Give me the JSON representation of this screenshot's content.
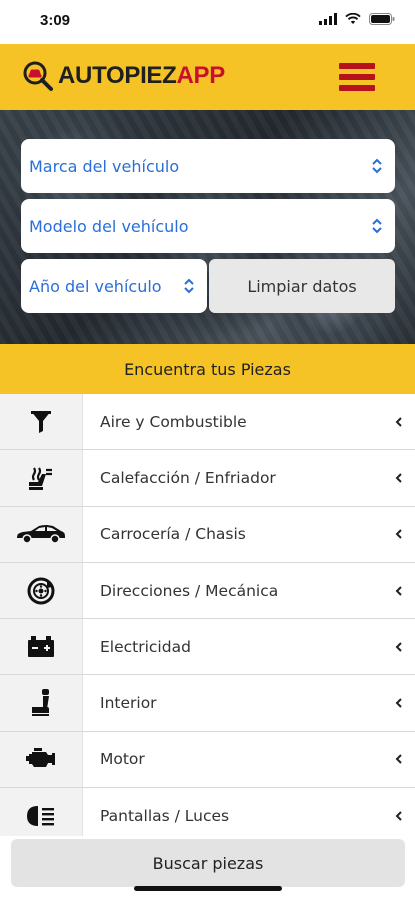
{
  "status_bar": {
    "time": "3:09"
  },
  "header": {
    "logo_part1": "AUTOPIEZ",
    "logo_part2": "APP"
  },
  "filters": {
    "brand_label": "Marca del vehículo",
    "model_label": "Modelo del vehículo",
    "year_label": "Año del vehículo",
    "clear_label": "Limpiar datos"
  },
  "section_title": "Encuentra tus Piezas",
  "categories": [
    {
      "label": "Aire y Combustible",
      "icon": "funnel-icon"
    },
    {
      "label": "Calefacción / Enfriador",
      "icon": "climate-seat-icon"
    },
    {
      "label": "Carrocería / Chasis",
      "icon": "car-icon"
    },
    {
      "label": "Direcciones / Mecánica",
      "icon": "brake-disc-icon"
    },
    {
      "label": "Electricidad",
      "icon": "battery-icon"
    },
    {
      "label": "Interior",
      "icon": "seat-icon"
    },
    {
      "label": "Motor",
      "icon": "engine-icon"
    },
    {
      "label": "Pantallas / Luces",
      "icon": "headlight-icon"
    }
  ],
  "search_button_label": "Buscar piezas",
  "colors": {
    "accent": "#f6c326",
    "brand_red": "#c8102e",
    "select_text": "#2a6fd9"
  }
}
